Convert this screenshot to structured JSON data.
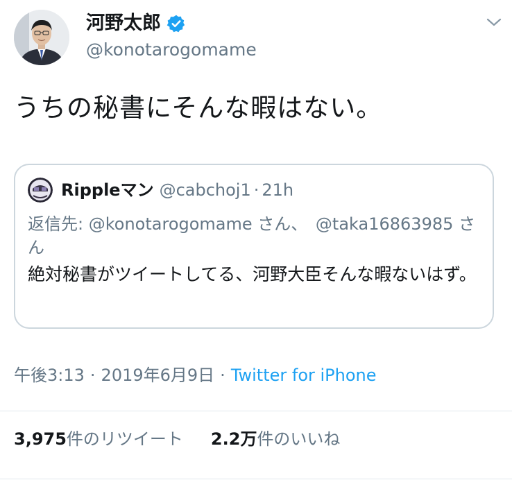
{
  "author": {
    "name": "河野太郎",
    "handle": "@konotarogomame",
    "verified": true
  },
  "tweet": {
    "text": "うちの秘書にそんな暇はない。"
  },
  "quoted": {
    "name": "Rippleマン",
    "handle": "@cabchoj1",
    "separator": "·",
    "time": "21h",
    "reply_prefix": "返信先:",
    "reply_mention_1": "@konotarogomame さん、",
    "reply_mention_2": "@taka16863985 さん",
    "text": "絶対秘書がツイートしてる、河野大臣そんな暇ないはず。"
  },
  "meta": {
    "time": "午後3:13",
    "separator": "·",
    "date": "2019年6月9日",
    "source": "Twitter for iPhone"
  },
  "stats": {
    "retweets_count": "3,975",
    "retweets_label": "件のリツイート",
    "likes_count": "2.2万",
    "likes_label": "件のいいね"
  },
  "colors": {
    "text": "#14171a",
    "secondary": "#657786",
    "link": "#1da1f2",
    "verified": "#1da1f2",
    "border": "#ccd6dd"
  }
}
